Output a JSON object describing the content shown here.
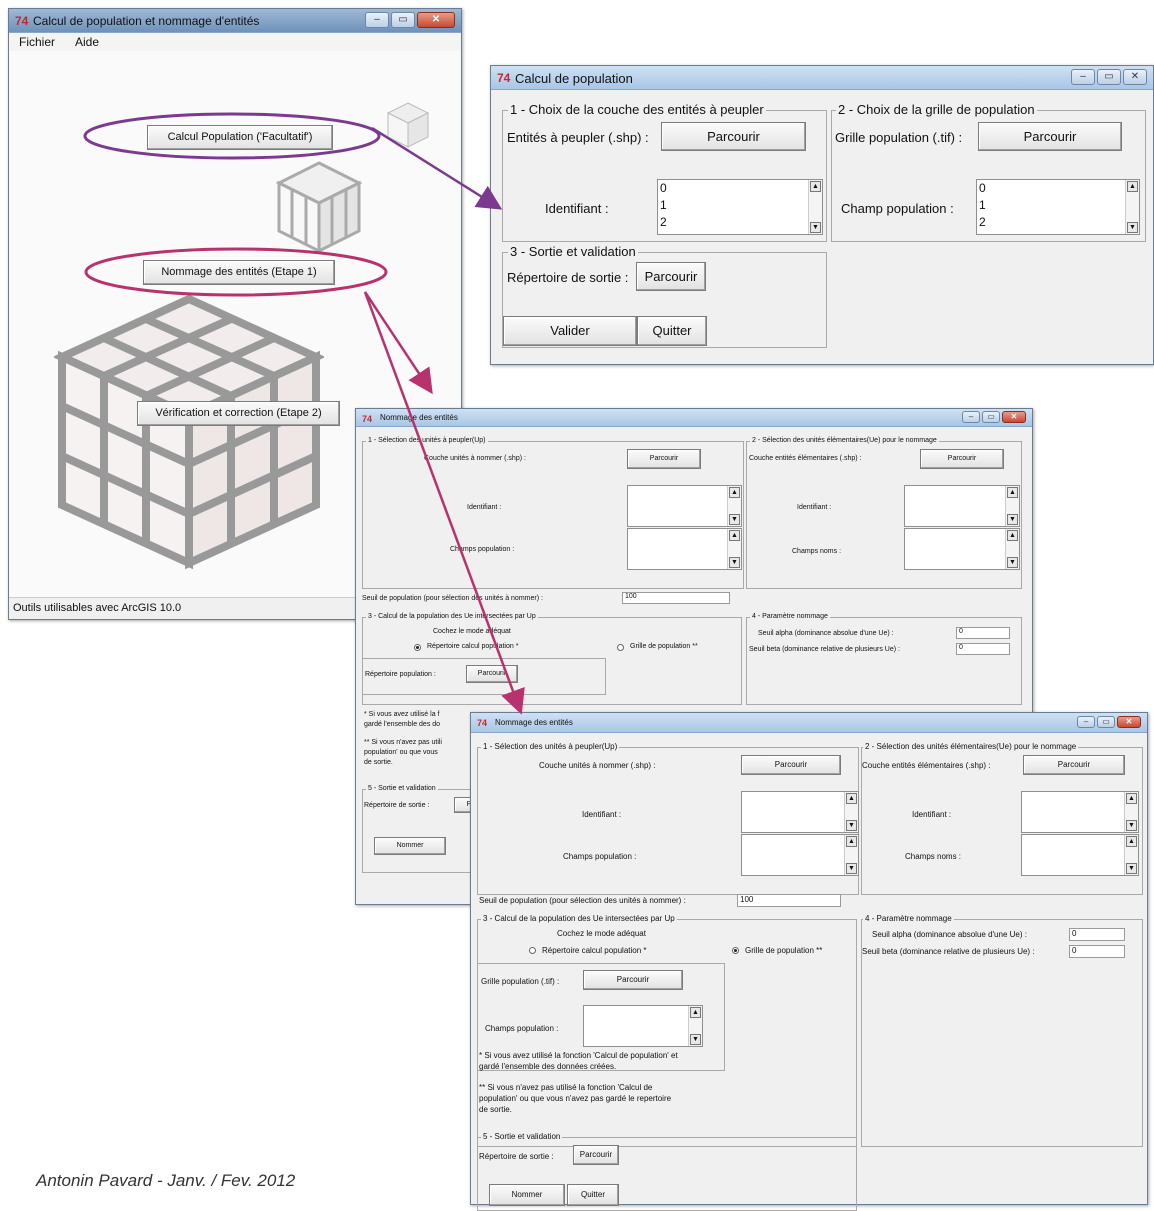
{
  "launcher": {
    "title": "Calcul de population et nommage d'entités",
    "menu": [
      "Fichier",
      "Aide"
    ],
    "buttons": {
      "calcul": "Calcul Population ('Facultatif')",
      "nommage": "Nommage des entités (Etape 1)",
      "verif": "Vérification et correction (Etape 2)"
    },
    "status": "Outils utilisables avec ArcGIS 10.0"
  },
  "calcul": {
    "title": "Calcul de population",
    "g1": {
      "title": "1 - Choix de la couche des entités à peupler",
      "file_label": "Entités à peupler (.shp) :",
      "browse": "Parcourir",
      "id_label": "Identifiant :",
      "list": [
        "0",
        "1",
        "2"
      ]
    },
    "g2": {
      "title": "2 - Choix de la grille de population",
      "file_label": "Grille population (.tif) :",
      "browse": "Parcourir",
      "field_label": "Champ population :",
      "list": [
        "0",
        "1",
        "2"
      ]
    },
    "g3": {
      "title": "3 - Sortie et validation",
      "dir_label": "Répertoire de sortie :",
      "browse": "Parcourir",
      "validate": "Valider",
      "quit": "Quitter"
    }
  },
  "nommage1": {
    "title": "Nommage des entités",
    "g1": {
      "title": "1 - Sélection des unités à peupler(Up)",
      "layer_label": "Couche unités à nommer (.shp) :",
      "browse": "Parcourir",
      "id_label": "Identifiant :",
      "pop_label": "Champs population :"
    },
    "g2": {
      "title": "2 - Sélection des unités élémentaires(Ue) pour le nommage",
      "layer_label": "Couche entités élémentaires (.shp) :",
      "browse": "Parcourir",
      "id_label": "Identifiant :",
      "names_label": "Champs noms :"
    },
    "threshold_label": "Seuil de population (pour sélection des unités à nommer) :",
    "threshold_value": "100",
    "g3": {
      "title": "3 - Calcul de la population des Ue intersectées par Up",
      "mode_label": "Cochez le mode adéquat",
      "radio1": "Répertoire calcul population *",
      "radio2": "Grille de population **",
      "dir_label": "Répertoire population :",
      "browse": "Parcourir",
      "note1_a": "* Si vous avez utilisé la f",
      "note1_b": "gardé l'ensemble des do",
      "note2_a": "** Si vous n'avez pas utili",
      "note2_b": "population' ou que vous",
      "note2_c": "de sortie."
    },
    "g4": {
      "title": "4 - Paramètre nommage",
      "alpha_label": "Seuil alpha (dominance absolue d'une Ue) :",
      "alpha_value": "0",
      "beta_label": "Seuil beta (dominance relative de plusieurs Ue) :",
      "beta_value": "0"
    },
    "g5": {
      "title": "5 - Sortie et validation",
      "dir_label": "Répertoire de sortie :",
      "browse_partial": "P",
      "name": "Nommer"
    }
  },
  "nommage2": {
    "title": "Nommage des entités",
    "g1": {
      "title": "1 - Sélection des unités à peupler(Up)",
      "layer_label": "Couche unités à nommer (.shp) :",
      "browse": "Parcourir",
      "id_label": "Identifiant :",
      "pop_label": "Champs population :"
    },
    "g2": {
      "title": "2 - Sélection des unités élémentaires(Ue) pour le nommage",
      "layer_label": "Couche entités élémentaires (.shp) :",
      "browse": "Parcourir",
      "id_label": "Identifiant :",
      "names_label": "Champs noms :"
    },
    "threshold_label": "Seuil de population (pour sélection des unités à nommer) :",
    "threshold_value": "100",
    "g3": {
      "title": "3 - Calcul de la population des Ue intersectées par Up",
      "mode_label": "Cochez le mode adéquat",
      "radio1": "Répertoire calcul population *",
      "radio2": "Grille de population **",
      "grid_label": "Grille population (.tif) :",
      "browse": "Parcourir",
      "pop_label": "Champs population :",
      "note1_a": "* Si vous avez utilisé la fonction 'Calcul de population' et",
      "note1_b": "gardé l'ensemble des données créées.",
      "note2_a": "** Si vous n'avez pas utilisé la fonction 'Calcul de",
      "note2_b": "population' ou que vous n'avez pas gardé le repertoire",
      "note2_c": "de sortie."
    },
    "g4": {
      "title": "4 - Paramètre nommage",
      "alpha_label": "Seuil alpha (dominance absolue d'une Ue) :",
      "alpha_value": "0",
      "beta_label": "Seuil beta (dominance relative de plusieurs Ue) :",
      "beta_value": "0"
    },
    "g5": {
      "title": "5 - Sortie et validation",
      "dir_label": "Répertoire de sortie :",
      "browse": "Parcourir",
      "name": "Nommer",
      "quit": "Quitter"
    }
  },
  "credit": "Antonin Pavard - Janv. / Fev. 2012",
  "colors": {
    "purple": "#7b3a8f",
    "magenta": "#b8326e"
  }
}
